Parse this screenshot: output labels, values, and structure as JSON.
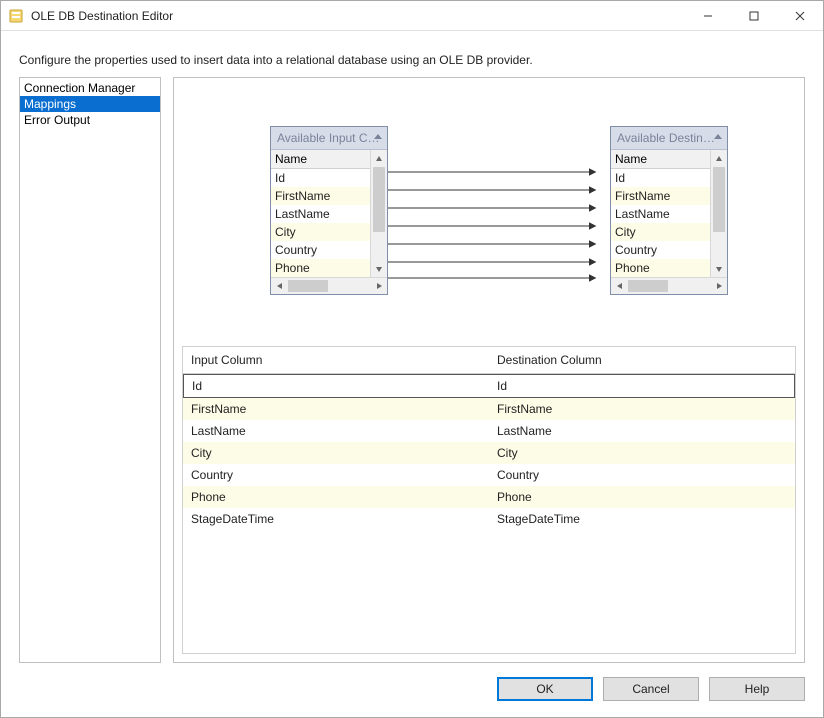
{
  "window": {
    "title": "OLE DB Destination Editor"
  },
  "description": "Configure the properties used to insert data into a relational database using an OLE DB provider.",
  "sidebar": {
    "items": [
      {
        "label": "Connection Manager",
        "selected": false
      },
      {
        "label": "Mappings",
        "selected": true
      },
      {
        "label": "Error Output",
        "selected": false
      }
    ]
  },
  "diagram": {
    "input_box": {
      "title": "Available Input Co...",
      "header": "Name",
      "rows": [
        "Id",
        "FirstName",
        "LastName",
        "City",
        "Country",
        "Phone"
      ]
    },
    "dest_box": {
      "title": "Available Destinati...",
      "header": "Name",
      "rows": [
        "Id",
        "FirstName",
        "LastName",
        "City",
        "Country",
        "Phone"
      ]
    }
  },
  "table": {
    "headers": {
      "input": "Input Column",
      "dest": "Destination Column"
    },
    "rows": [
      {
        "input": "Id",
        "dest": "Id"
      },
      {
        "input": "FirstName",
        "dest": "FirstName"
      },
      {
        "input": "LastName",
        "dest": "LastName"
      },
      {
        "input": "City",
        "dest": "City"
      },
      {
        "input": "Country",
        "dest": "Country"
      },
      {
        "input": "Phone",
        "dest": "Phone"
      },
      {
        "input": "StageDateTime",
        "dest": "StageDateTime"
      }
    ]
  },
  "buttons": {
    "ok": "OK",
    "cancel": "Cancel",
    "help": "Help"
  }
}
